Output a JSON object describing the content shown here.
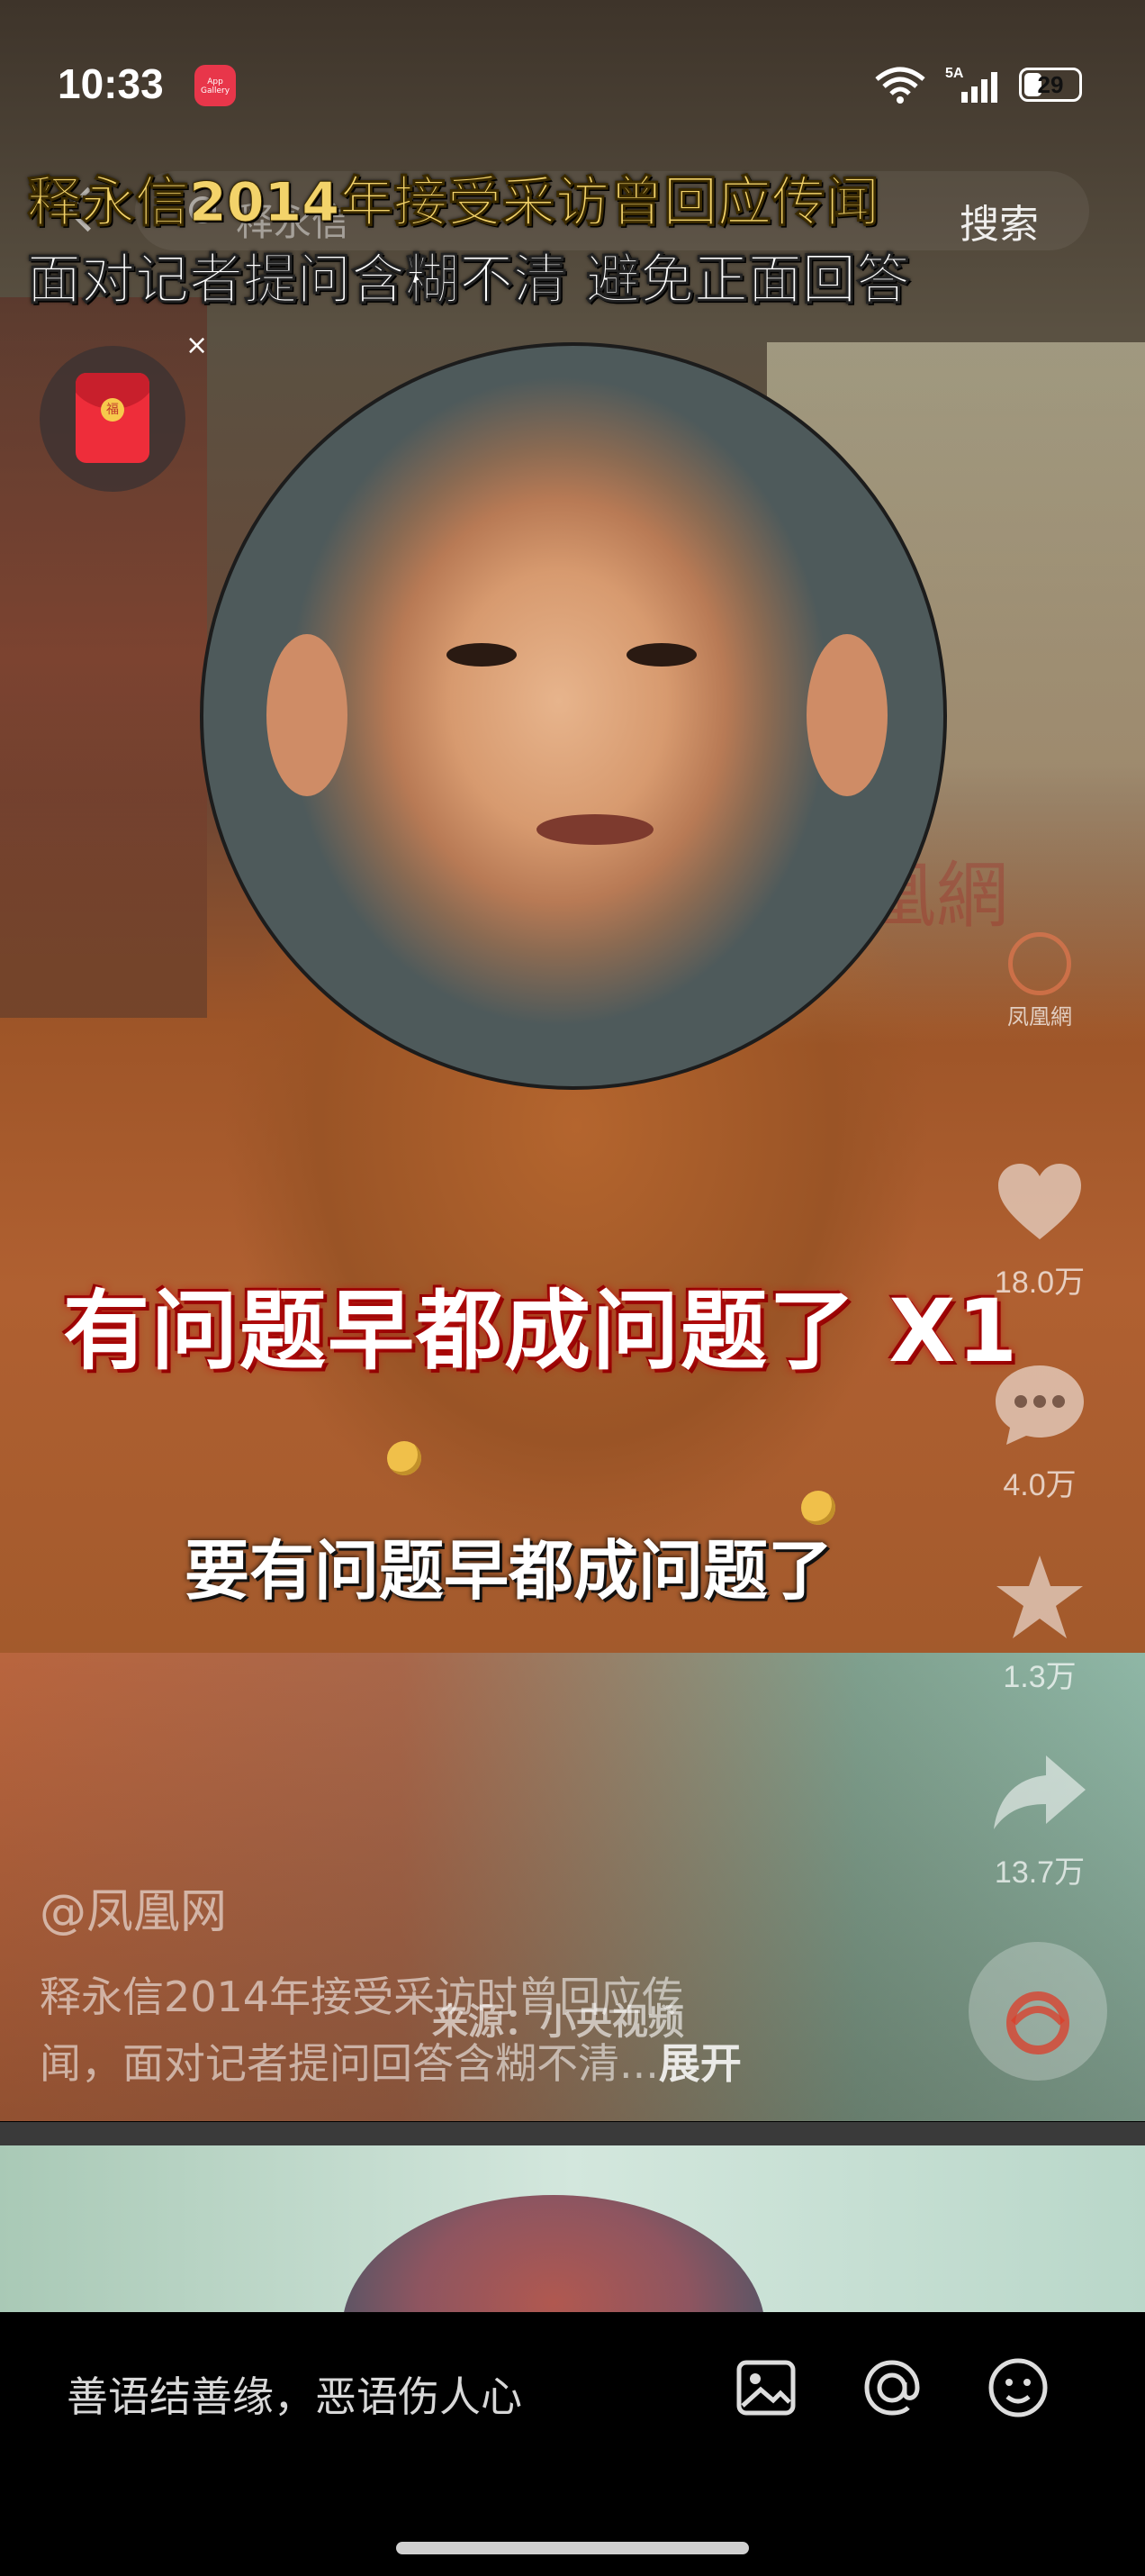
{
  "status_bar": {
    "time": "10:33",
    "app_badge": "App Gallery",
    "network": "5A",
    "wifi_label": "6",
    "battery": "29"
  },
  "headline": {
    "line1": "释永信2014年接受采访曾回应传闻",
    "line2": "面对记者提问含糊不清  避免正面回答"
  },
  "search": {
    "query": "释永信",
    "button": "搜索"
  },
  "red_packet": {
    "close": "×",
    "coin": "福"
  },
  "video": {
    "watermark": "凤凰網",
    "caption_big": "有问题早都成问题了 X1",
    "caption_small": "要有问题早都成问题了",
    "progress": 0.0
  },
  "actions": {
    "like_count": "18.0万",
    "comment_count": "4.0万",
    "favorite_count": "1.3万",
    "share_count": "13.7万"
  },
  "post": {
    "author": "@凤凰网",
    "description_line1": "释永信2014年接受采访时曾回应传",
    "description_line2": "闻，面对记者提问回答含糊不清...",
    "expand": "展开",
    "source": "来源：小央视频"
  },
  "comment_bar": {
    "placeholder": "善语结善缘，恶语伤人心"
  },
  "colors": {
    "headline_yellow": "#f3d36a",
    "caption_red_glow": "#c01010",
    "background": "#000000"
  }
}
